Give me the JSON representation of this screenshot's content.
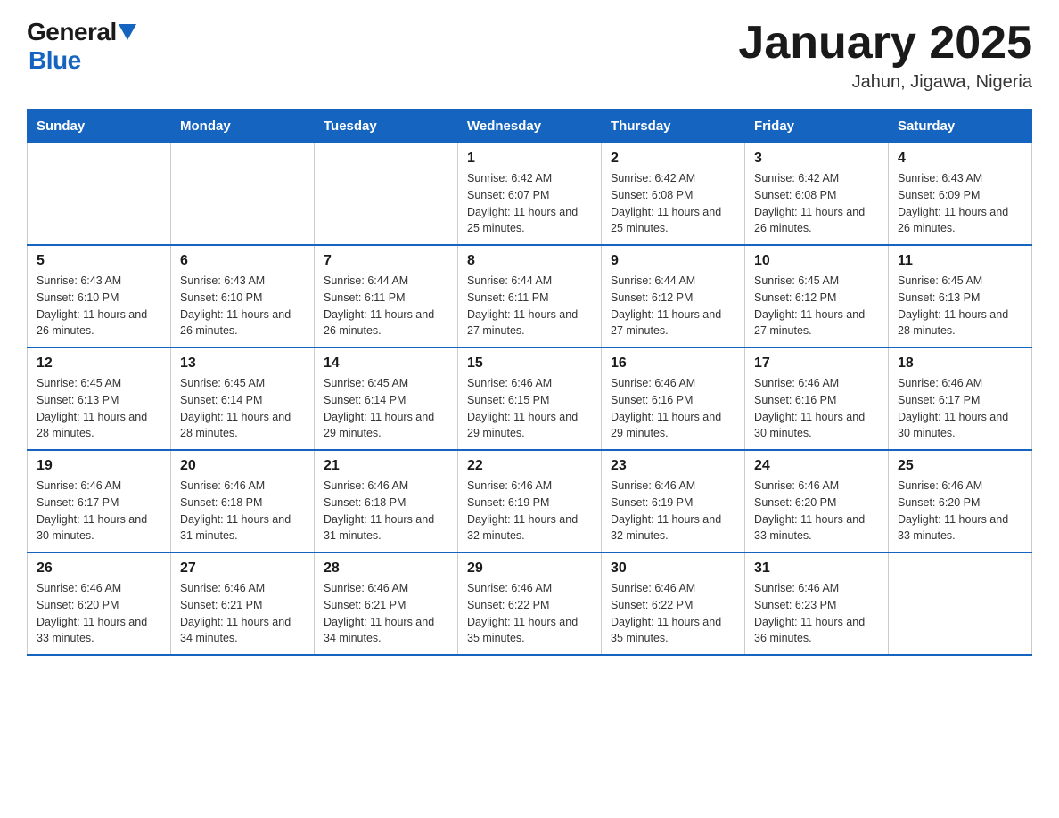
{
  "header": {
    "logo_general": "General",
    "logo_blue": "Blue",
    "title": "January 2025",
    "subtitle": "Jahun, Jigawa, Nigeria"
  },
  "calendar": {
    "days_of_week": [
      "Sunday",
      "Monday",
      "Tuesday",
      "Wednesday",
      "Thursday",
      "Friday",
      "Saturday"
    ],
    "weeks": [
      [
        {
          "day": "",
          "info": ""
        },
        {
          "day": "",
          "info": ""
        },
        {
          "day": "",
          "info": ""
        },
        {
          "day": "1",
          "info": "Sunrise: 6:42 AM\nSunset: 6:07 PM\nDaylight: 11 hours and 25 minutes."
        },
        {
          "day": "2",
          "info": "Sunrise: 6:42 AM\nSunset: 6:08 PM\nDaylight: 11 hours and 25 minutes."
        },
        {
          "day": "3",
          "info": "Sunrise: 6:42 AM\nSunset: 6:08 PM\nDaylight: 11 hours and 26 minutes."
        },
        {
          "day": "4",
          "info": "Sunrise: 6:43 AM\nSunset: 6:09 PM\nDaylight: 11 hours and 26 minutes."
        }
      ],
      [
        {
          "day": "5",
          "info": "Sunrise: 6:43 AM\nSunset: 6:10 PM\nDaylight: 11 hours and 26 minutes."
        },
        {
          "day": "6",
          "info": "Sunrise: 6:43 AM\nSunset: 6:10 PM\nDaylight: 11 hours and 26 minutes."
        },
        {
          "day": "7",
          "info": "Sunrise: 6:44 AM\nSunset: 6:11 PM\nDaylight: 11 hours and 26 minutes."
        },
        {
          "day": "8",
          "info": "Sunrise: 6:44 AM\nSunset: 6:11 PM\nDaylight: 11 hours and 27 minutes."
        },
        {
          "day": "9",
          "info": "Sunrise: 6:44 AM\nSunset: 6:12 PM\nDaylight: 11 hours and 27 minutes."
        },
        {
          "day": "10",
          "info": "Sunrise: 6:45 AM\nSunset: 6:12 PM\nDaylight: 11 hours and 27 minutes."
        },
        {
          "day": "11",
          "info": "Sunrise: 6:45 AM\nSunset: 6:13 PM\nDaylight: 11 hours and 28 minutes."
        }
      ],
      [
        {
          "day": "12",
          "info": "Sunrise: 6:45 AM\nSunset: 6:13 PM\nDaylight: 11 hours and 28 minutes."
        },
        {
          "day": "13",
          "info": "Sunrise: 6:45 AM\nSunset: 6:14 PM\nDaylight: 11 hours and 28 minutes."
        },
        {
          "day": "14",
          "info": "Sunrise: 6:45 AM\nSunset: 6:14 PM\nDaylight: 11 hours and 29 minutes."
        },
        {
          "day": "15",
          "info": "Sunrise: 6:46 AM\nSunset: 6:15 PM\nDaylight: 11 hours and 29 minutes."
        },
        {
          "day": "16",
          "info": "Sunrise: 6:46 AM\nSunset: 6:16 PM\nDaylight: 11 hours and 29 minutes."
        },
        {
          "day": "17",
          "info": "Sunrise: 6:46 AM\nSunset: 6:16 PM\nDaylight: 11 hours and 30 minutes."
        },
        {
          "day": "18",
          "info": "Sunrise: 6:46 AM\nSunset: 6:17 PM\nDaylight: 11 hours and 30 minutes."
        }
      ],
      [
        {
          "day": "19",
          "info": "Sunrise: 6:46 AM\nSunset: 6:17 PM\nDaylight: 11 hours and 30 minutes."
        },
        {
          "day": "20",
          "info": "Sunrise: 6:46 AM\nSunset: 6:18 PM\nDaylight: 11 hours and 31 minutes."
        },
        {
          "day": "21",
          "info": "Sunrise: 6:46 AM\nSunset: 6:18 PM\nDaylight: 11 hours and 31 minutes."
        },
        {
          "day": "22",
          "info": "Sunrise: 6:46 AM\nSunset: 6:19 PM\nDaylight: 11 hours and 32 minutes."
        },
        {
          "day": "23",
          "info": "Sunrise: 6:46 AM\nSunset: 6:19 PM\nDaylight: 11 hours and 32 minutes."
        },
        {
          "day": "24",
          "info": "Sunrise: 6:46 AM\nSunset: 6:20 PM\nDaylight: 11 hours and 33 minutes."
        },
        {
          "day": "25",
          "info": "Sunrise: 6:46 AM\nSunset: 6:20 PM\nDaylight: 11 hours and 33 minutes."
        }
      ],
      [
        {
          "day": "26",
          "info": "Sunrise: 6:46 AM\nSunset: 6:20 PM\nDaylight: 11 hours and 33 minutes."
        },
        {
          "day": "27",
          "info": "Sunrise: 6:46 AM\nSunset: 6:21 PM\nDaylight: 11 hours and 34 minutes."
        },
        {
          "day": "28",
          "info": "Sunrise: 6:46 AM\nSunset: 6:21 PM\nDaylight: 11 hours and 34 minutes."
        },
        {
          "day": "29",
          "info": "Sunrise: 6:46 AM\nSunset: 6:22 PM\nDaylight: 11 hours and 35 minutes."
        },
        {
          "day": "30",
          "info": "Sunrise: 6:46 AM\nSunset: 6:22 PM\nDaylight: 11 hours and 35 minutes."
        },
        {
          "day": "31",
          "info": "Sunrise: 6:46 AM\nSunset: 6:23 PM\nDaylight: 11 hours and 36 minutes."
        },
        {
          "day": "",
          "info": ""
        }
      ]
    ]
  }
}
